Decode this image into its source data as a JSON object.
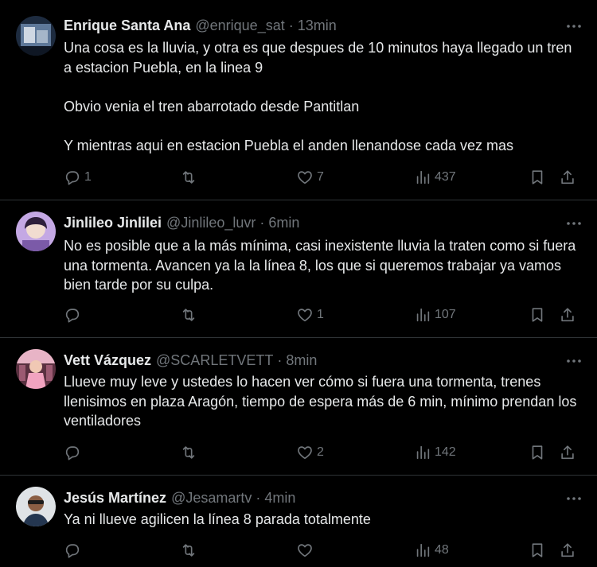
{
  "tweets": [
    {
      "display_name": "Enrique Santa Ana",
      "handle": "@enrique_sat",
      "separator": "·",
      "time": "13min",
      "paragraphs": [
        "Una cosa es la lluvia, y otra es que despues de 10 minutos haya llegado un tren a estacion Puebla, en la linea 9",
        "Obvio venia el tren abarrotado desde Pantitlan",
        "Y mientras aqui en estacion Puebla el anden llenandose cada vez mas"
      ],
      "replies": "1",
      "retweets": "",
      "likes": "7",
      "views": "437",
      "avatar_colors": [
        "#2a3a52",
        "#c9d4e0"
      ]
    },
    {
      "display_name": "Jinlileo Jinlilei",
      "handle": "@Jinlileo_luvr",
      "separator": "·",
      "time": "6min",
      "paragraphs": [
        "No es posible que a la más mínima, casi inexistente lluvia la traten como si fuera una tormenta. Avancen ya la la línea 8, los que si queremos trabajar ya vamos bien tarde por su culpa."
      ],
      "replies": "",
      "retweets": "",
      "likes": "1",
      "views": "107",
      "avatar_colors": [
        "#b99ad8",
        "#3c2a4e"
      ]
    },
    {
      "display_name": "Vett Vázquez",
      "handle": "@SCARLETVETT",
      "separator": "·",
      "time": "8min",
      "paragraphs": [
        "Llueve muy leve y ustedes lo hacen ver cómo si fuera una tormenta, trenes llenisimos en plaza Aragón, tiempo de espera más de 6 min, mínimo prendan los ventiladores"
      ],
      "replies": "",
      "retweets": "",
      "likes": "2",
      "views": "142",
      "avatar_colors": [
        "#e6a2b8",
        "#7a4a5a"
      ]
    },
    {
      "display_name": "Jesús Martínez",
      "handle": "@Jesamartv",
      "separator": "·",
      "time": "4min",
      "paragraphs": [
        "Ya ni llueve agilicen la línea 8 parada totalmente"
      ],
      "replies": "",
      "retweets": "",
      "likes": "",
      "views": "48",
      "avatar_colors": [
        "#d9dde0",
        "#6b4c3b"
      ]
    }
  ],
  "colors": {
    "background": "#000000",
    "primary_text": "#e7e9ea",
    "secondary_text": "#71767b",
    "divider": "#2f3336"
  },
  "icons": [
    "reply-icon",
    "retweet-icon",
    "like-icon",
    "views-icon",
    "bookmark-icon",
    "share-icon",
    "more-icon"
  ]
}
